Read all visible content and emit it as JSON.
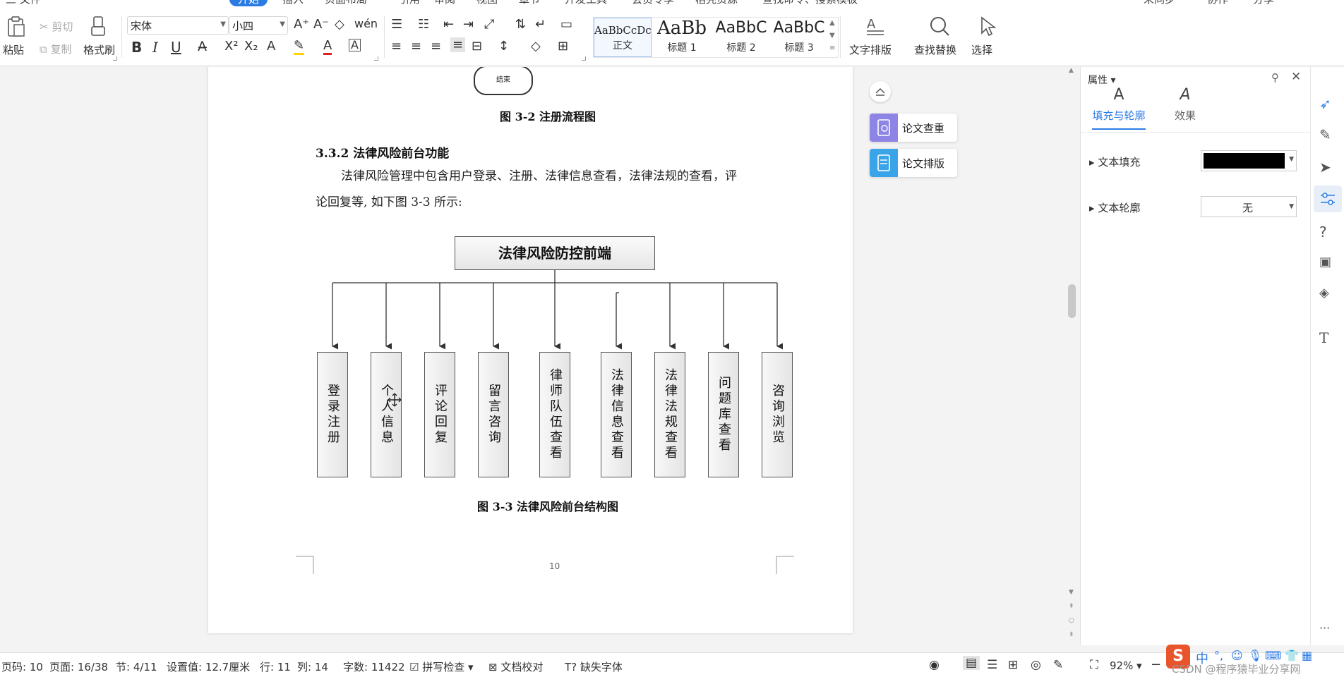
{
  "menubar": {
    "file": "三 文件",
    "active_tab": "开始",
    "tabs": [
      "插入",
      "页面布局",
      "引用",
      "审阅",
      "视图",
      "章节",
      "开发工具",
      "会员专享",
      "稻壳资源"
    ],
    "search": "查找命令、搜索模板",
    "right": [
      "未同步",
      "协作",
      "分享"
    ]
  },
  "ribbon": {
    "paste": "粘贴",
    "cut": "剪切",
    "copy": "复制",
    "format_painter": "格式刷",
    "font_name": "宋体",
    "font_size": "小四",
    "styles": [
      {
        "sample": "AaBbCcDc",
        "name": "正文"
      },
      {
        "sample": "AaBb",
        "name": "标题 1"
      },
      {
        "sample": "AaBbC",
        "name": "标题 2"
      },
      {
        "sample": "AaBbC",
        "name": "标题 3"
      }
    ],
    "text_layout": "文字排版",
    "find_replace": "查找替换",
    "select": "选择"
  },
  "document": {
    "end_node": "结束",
    "fig32_caption": "图 3-2 注册流程图",
    "section_heading": "3.3.2  法律风险前台功能",
    "paragraph_line1": "法律风险管理中包含用户登录、注册、法律信息查看，法律法规的查看，评",
    "paragraph_line2": "论回复等, 如下图 3-3 所示:",
    "org_root": "法律风险防控前端",
    "org_children": [
      "登录注册",
      "个人信息",
      "评论回复",
      "留言咨询",
      "律师队伍查看",
      "法律信息查看",
      "法律法规查看",
      "问题库查看",
      "咨询浏览"
    ],
    "fig33_caption": "图 3-3 法律风险前台结构图",
    "page_number": "10"
  },
  "float_tools": {
    "check": "论文查重",
    "layout": "论文排版"
  },
  "panel": {
    "title": "属性",
    "tab_fill": "填充与轮廓",
    "tab_effect": "效果",
    "text_fill_label": "文本填充",
    "text_fill_color": "#000000",
    "text_outline_label": "文本轮廓",
    "text_outline_value": "无"
  },
  "statusbar": {
    "page_code": "页码: 10",
    "page": "页面: 16/38",
    "section": "节: 4/11",
    "setting": "设置值: 12.7厘米",
    "row": "行: 11",
    "col": "列: 14",
    "word_count": "字数: 11422",
    "spell_check": "拼写检查",
    "doc_proof": "文档校对",
    "missing_font": "缺失字体",
    "zoom": "92%",
    "watermark": "CSDN @程序猿毕业分享网"
  },
  "colors": {
    "accent": "#2c7be5",
    "page": "#ffffff",
    "background": "#f3f3f3"
  }
}
